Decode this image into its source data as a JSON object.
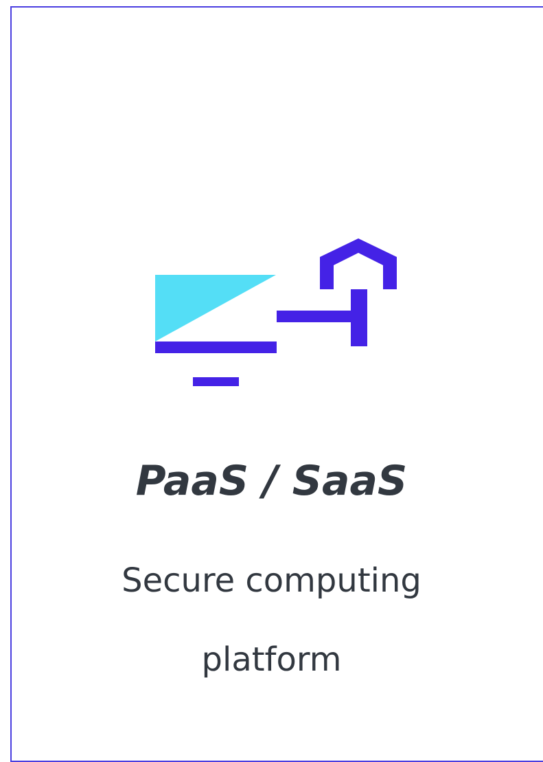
{
  "card": {
    "icon": "computer-with-house-icon",
    "title": "PaaS / SaaS",
    "description_lines": [
      "Secure computing",
      "platform"
    ]
  },
  "colors": {
    "border": "#4a3ee0",
    "icon_primary": "#4422e6",
    "icon_accent": "#54def6",
    "text": "#323840"
  }
}
